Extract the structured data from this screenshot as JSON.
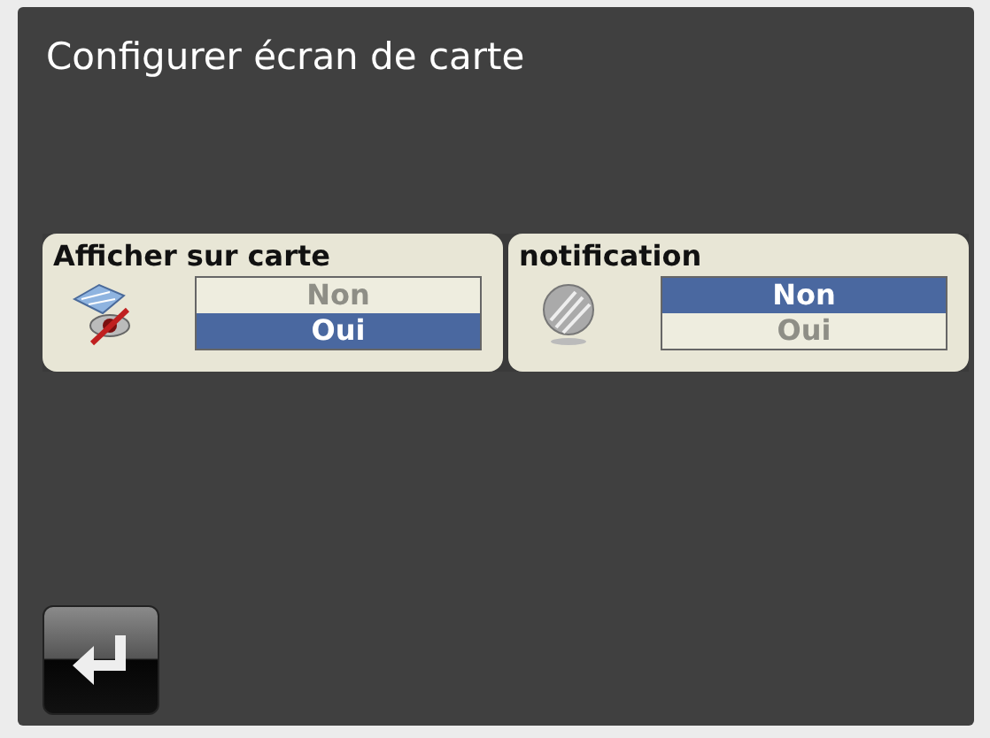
{
  "title": "Configurer écran de carte",
  "settings": [
    {
      "label": "Afficher sur carte",
      "kind": "map",
      "options": [
        {
          "label": "Non",
          "selected": false
        },
        {
          "label": "Oui",
          "selected": true
        }
      ]
    },
    {
      "label": "notification",
      "kind": "sphere",
      "options": [
        {
          "label": "Non",
          "selected": true
        },
        {
          "label": "Oui",
          "selected": false
        }
      ]
    }
  ]
}
